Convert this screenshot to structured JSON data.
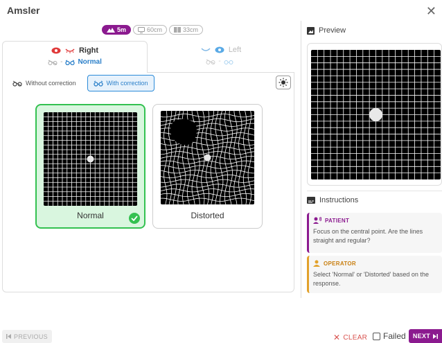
{
  "app": {
    "title": "Amsler",
    "close_icon": "close-icon"
  },
  "distances": [
    {
      "label": "5m",
      "icon": "mountain-icon",
      "active": true
    },
    {
      "label": "60cm",
      "icon": "monitor-icon",
      "active": false
    },
    {
      "label": "33cm",
      "icon": "book-icon",
      "active": false
    }
  ],
  "eyes": {
    "right": {
      "label": "Right",
      "status": "Normal",
      "dash": "-",
      "active": true
    },
    "left": {
      "label": "Left",
      "status": "",
      "dash": "-",
      "active": false
    }
  },
  "correction": {
    "without_label": "Without correction",
    "with_label": "With correction",
    "selected": "with"
  },
  "options": {
    "normal_label": "Normal",
    "distorted_label": "Distorted",
    "selected": "normal"
  },
  "preview": {
    "title": "Preview"
  },
  "instructions": {
    "title": "Instructions",
    "patient": {
      "heading": "PATIENT",
      "text": "Focus on the central point. Are the lines straight and regular?"
    },
    "operator": {
      "heading": "OPERATOR",
      "text": "Select 'Normal' or 'Distorted' based on the response."
    }
  },
  "footer": {
    "previous_label": "PREVIOUS",
    "clear_label": "CLEAR",
    "failed_label": "Failed",
    "failed_checked": false,
    "next_label": "NEXT"
  },
  "colors": {
    "brand": "#8b1a8f",
    "selected_green": "#33c150",
    "accent_blue": "#2a8ad8",
    "eye_red": "#e03a3a",
    "clear_red": "#d9534f",
    "operator_orange": "#e2a12a"
  }
}
